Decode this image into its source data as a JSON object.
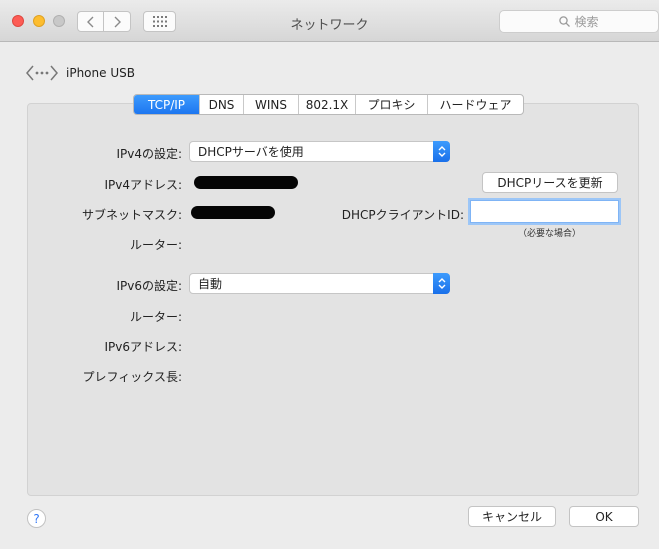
{
  "window": {
    "title": "ネットワーク",
    "search_placeholder": "検索"
  },
  "header": {
    "interface_name": "iPhone USB"
  },
  "tabs": [
    {
      "label": "TCP/IP",
      "active": true
    },
    {
      "label": "DNS",
      "active": false
    },
    {
      "label": "WINS",
      "active": false
    },
    {
      "label": "802.1X",
      "active": false
    },
    {
      "label": "プロキシ",
      "active": false
    },
    {
      "label": "ハードウェア",
      "active": false
    }
  ],
  "form": {
    "ipv4_config_label": "IPv4の設定:",
    "ipv4_config_value": "DHCPサーバを使用",
    "ipv4_address_label": "IPv4アドレス:",
    "subnet_mask_label": "サブネットマスク:",
    "router_label": "ルーター:",
    "renew_dhcp_button": "DHCPリースを更新",
    "dhcp_client_id_label": "DHCPクライアントID:",
    "dhcp_client_id_value": "",
    "dhcp_client_id_hint": "（必要な場合）",
    "ipv6_config_label": "IPv6の設定:",
    "ipv6_config_value": "自動",
    "ipv6_router_label": "ルーター:",
    "ipv6_address_label": "IPv6アドレス:",
    "prefix_length_label": "プレフィックス長:"
  },
  "footer": {
    "cancel_label": "キャンセル",
    "ok_label": "OK",
    "help_label": "?"
  },
  "colors": {
    "accent": "#1d76f0",
    "close": "#fd5c55",
    "minimize": "#fdbd2f"
  }
}
